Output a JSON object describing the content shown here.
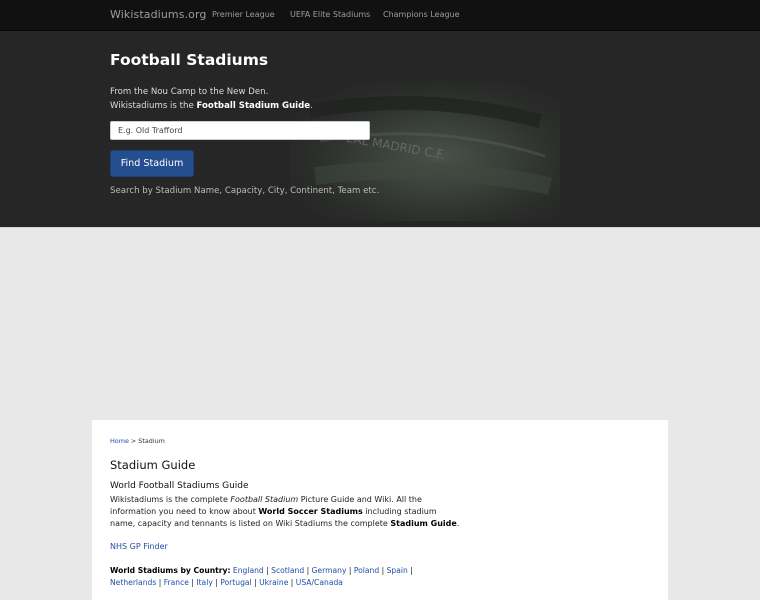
{
  "navbar": {
    "brand": "Wikistadiums.org",
    "links": [
      "Premier League",
      "UEFA Elite Stadiums",
      "Champions League"
    ]
  },
  "hero": {
    "title": "Football Stadiums",
    "line1": "From the Nou Camp to the New Den.",
    "line2_prefix": "Wikistadiums is the ",
    "line2_bold": "Football Stadium Guide",
    "line2_suffix": ".",
    "search_placeholder": "E.g. Old Trafford",
    "button_label": "Find Stadium",
    "hint": "Search by Stadium Name, Capacity, City, Continent, Team etc.",
    "image_text": "EAL MADRID C.F."
  },
  "content": {
    "breadcrumb": {
      "home": "Home",
      "separator": " > ",
      "current": "Stadium"
    },
    "heading": "Stadium Guide",
    "subheading": "World Football Stadiums Guide",
    "para": {
      "t1": "Wikistadiums is the complete ",
      "i1": "Football Stadium",
      "t2": " Picture Guide and Wiki. All the information you need to know about ",
      "b1": "World Soccer Stadiums",
      "t3": " including stadium name, capacity and tennants is listed on Wiki Stadiums the complete ",
      "b2": "Stadium Guide",
      "t4": "."
    },
    "nhs_link": "NHS GP Finder",
    "countries_label": "World Stadiums by Country:",
    "countries": [
      "England",
      "Scotland",
      "Germany",
      "Poland",
      "Spain",
      "Netherlands",
      "France",
      "Italy",
      "Portugal",
      "Ukraine",
      "USA/Canada"
    ]
  },
  "colors": {
    "navbar_bg": "#111111",
    "hero_bg": "#262626",
    "button_bg": "#254e8f",
    "link": "#1f4fa6",
    "page_bg": "#e8e8e8"
  }
}
